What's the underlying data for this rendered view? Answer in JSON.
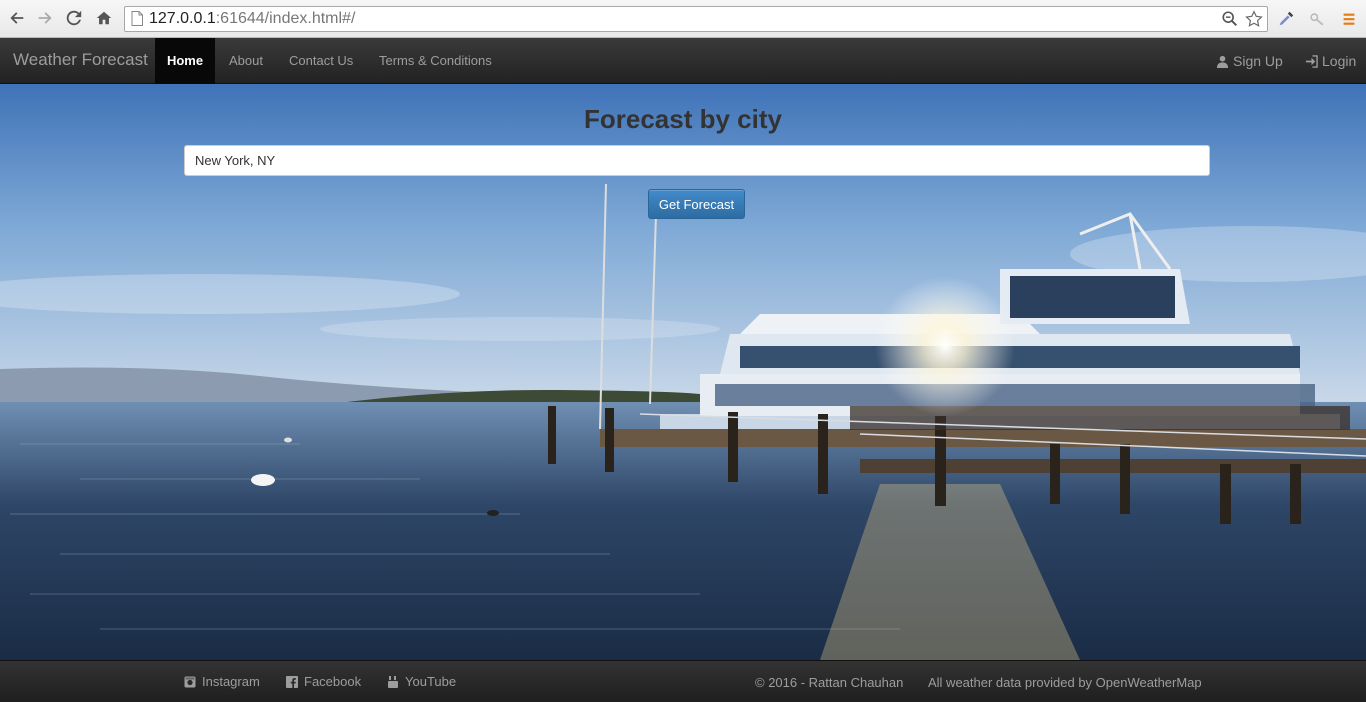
{
  "browser": {
    "address_host": "127.0.0.1",
    "address_rest": ":61644/index.html#/"
  },
  "navbar": {
    "brand": "Weather Forecast",
    "items": [
      {
        "label": "Home",
        "active": true
      },
      {
        "label": "About"
      },
      {
        "label": "Contact Us"
      },
      {
        "label": "Terms & Conditions"
      }
    ],
    "signup_label": "Sign Up",
    "login_label": "Login"
  },
  "main": {
    "title": "Forecast by city",
    "city_input_value": "New York, NY",
    "button_label": "Get Forecast"
  },
  "footer": {
    "instagram_label": "Instagram",
    "facebook_label": "Facebook",
    "youtube_label": "YouTube",
    "copyright": "© 2016 - Rattan Chauhan",
    "credit": "All weather data provided by OpenWeatherMap"
  },
  "icons": {
    "back": "back-arrow-icon",
    "forward": "forward-arrow-icon",
    "reload": "reload-icon",
    "home": "home-icon",
    "page": "page-icon",
    "zoom": "zoom-icon",
    "bookmark": "star-icon",
    "eyedropper": "eyedropper-icon",
    "key": "key-icon",
    "menu": "hamburger-menu-icon",
    "user": "user-icon",
    "login": "login-icon",
    "instagram": "instagram-icon",
    "facebook": "facebook-icon",
    "youtube": "youtube-icon"
  },
  "colors": {
    "navbar_bg": "#222222",
    "primary_button": "#428bca",
    "menu_accent": "#e37d16"
  }
}
